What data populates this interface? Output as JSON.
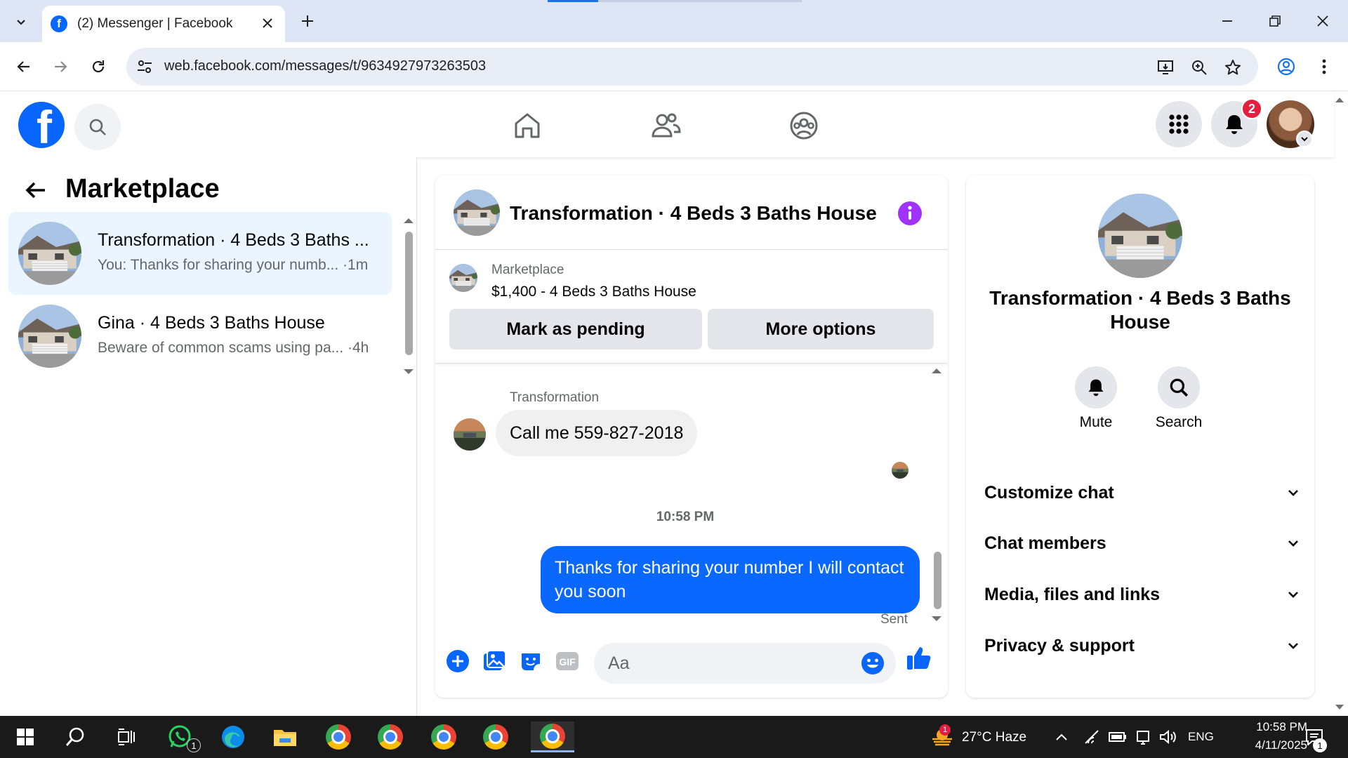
{
  "browser": {
    "tab_title": "(2) Messenger | Facebook",
    "url": "web.facebook.com/messages/t/9634927973263503"
  },
  "header": {
    "notification_count": "2"
  },
  "sidebar": {
    "title": "Marketplace",
    "conversations": [
      {
        "name": "Transformation · 4 Beds 3 Baths ...",
        "preview": "You: Thanks for sharing your numb... ·1m",
        "active": true
      },
      {
        "name": "Gina · 4 Beds 3 Baths House",
        "preview": "Beware of common scams using pa... ·4h",
        "active": false
      }
    ]
  },
  "chat": {
    "title": "Transformation · 4 Beds 3 Baths House",
    "listing_label": "Marketplace",
    "listing_price": "$1,400 - 4 Beds 3 Baths House",
    "mark_pending_label": "Mark as pending",
    "more_options_label": "More options",
    "sender_name": "Transformation",
    "incoming_message": "Call me 559-827-2018",
    "timestamp": "10:58 PM",
    "outgoing_message": "Thanks for sharing your number I will contact you soon",
    "sent_status": "Sent",
    "composer_placeholder": "Aa"
  },
  "info_panel": {
    "title": "Transformation · 4 Beds 3 Baths House",
    "mute_label": "Mute",
    "search_label": "Search",
    "sections": [
      "Customize chat",
      "Chat members",
      "Media, files and links",
      "Privacy & support"
    ]
  },
  "taskbar": {
    "whatsapp_count": "1",
    "weather_alert": "1",
    "weather": "27°C  Haze",
    "language": "ENG",
    "time": "10:58 PM",
    "date": "4/11/2025",
    "notification_count": "1"
  },
  "colors": {
    "brand_blue": "#0866ff",
    "messenger_blue": "#0a68ff",
    "info_purple": "#a033ff",
    "badge_red": "#e41e3f"
  }
}
